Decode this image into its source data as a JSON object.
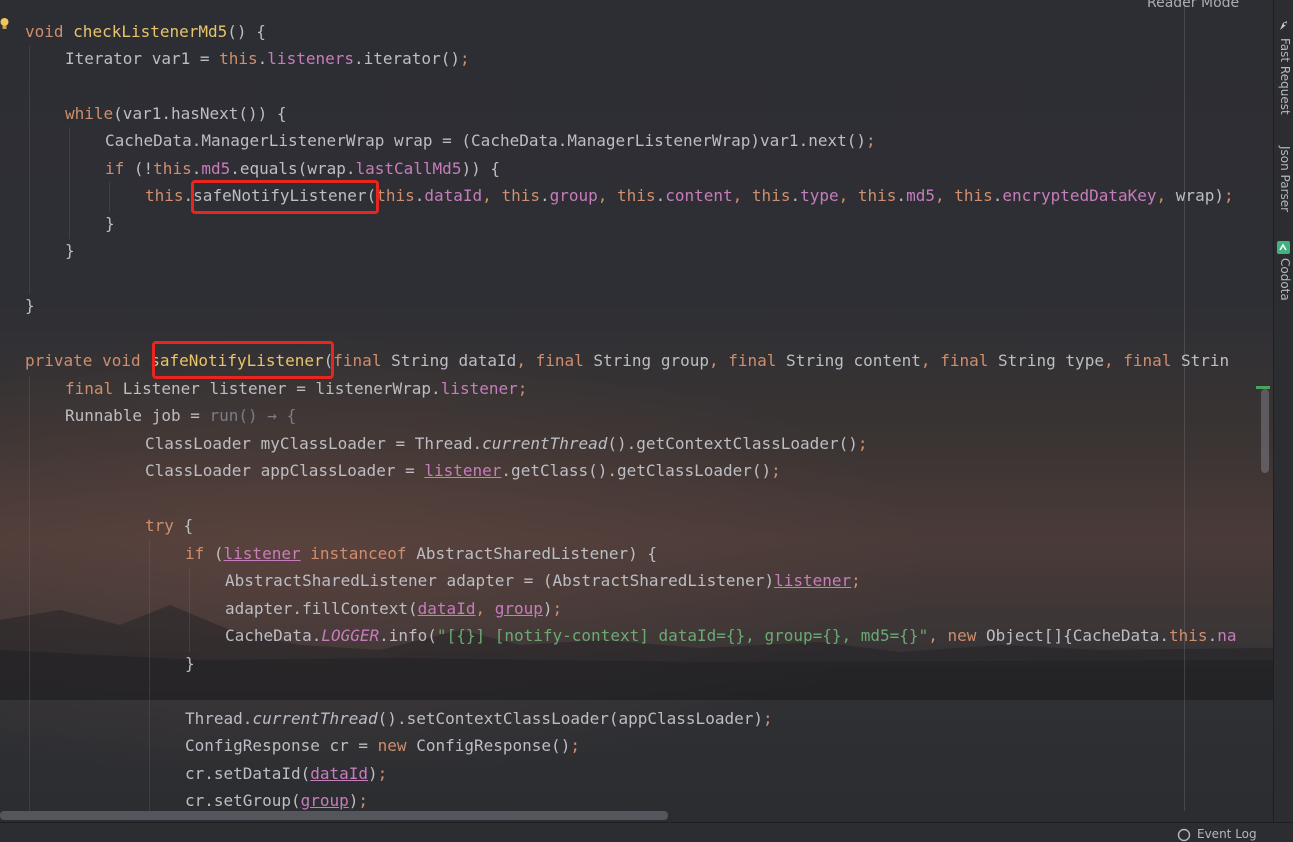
{
  "header": {
    "reader_mode": "Reader Mode"
  },
  "side_tools": [
    {
      "label": "Fast Request",
      "icon": "rocket-icon"
    },
    {
      "label": "Json Parser",
      "icon": "json-icon"
    },
    {
      "label": "Codota",
      "icon": "codota-icon"
    }
  ],
  "status_bar": {
    "event_log": "Event Log"
  },
  "colors": {
    "keyword": "#cf8e6d",
    "method_declaration": "#e8c46a",
    "field": "#c77dbb",
    "string": "#6aab73",
    "plain": "#bcbec4",
    "highlight_box": "#e8251f"
  },
  "code": {
    "l1_void": "void",
    "l1_name": "checkListenerMd5",
    "l1_rest": "() {",
    "l2_a": "Iterator var1 = ",
    "l2_this": "this",
    "l2_dot": ".",
    "l2_field": "listeners",
    "l2_b": ".iterator()",
    "l2_semi": ";",
    "l4_while": "while",
    "l4_rest": "(var1.hasNext()) {",
    "l5_a": "CacheData.ManagerListenerWrap wrap = (CacheData.ManagerListenerWrap)var1.next()",
    "l5_semi": ";",
    "l6_if": "if",
    "l6_a": " (!",
    "l6_this": "this",
    "l6_dot": ".",
    "l6_md5": "md5",
    "l6_b": ".equals(wrap.",
    "l6_last": "lastCallMd5",
    "l6_c": ")) {",
    "l7_this": "this",
    "l7_dot": ".",
    "l7_method": "safeNotifyListener",
    "l7_open": "(",
    "l7_args": [
      {
        "kw": "this",
        "field": "dataId",
        "sep": ", "
      },
      {
        "kw": "this",
        "field": "group",
        "sep": ", "
      },
      {
        "kw": "this",
        "field": "content",
        "sep": ", "
      },
      {
        "kw": "this",
        "field": "type",
        "sep": ", "
      },
      {
        "kw": "this",
        "field": "md5",
        "sep": ", "
      },
      {
        "kw": "this",
        "field": "encryptedDataKey",
        "sep": ", "
      }
    ],
    "l7_tail": "wrap)",
    "l7_semi": ";",
    "close_brace": "}",
    "l14_private": "private",
    "l14_void": "void",
    "l14_name": "safeNotifyListener",
    "l14_params": [
      {
        "kw": "final",
        "text": " String dataId",
        "sep": ", "
      },
      {
        "kw": "final",
        "text": " String group",
        "sep": ", "
      },
      {
        "kw": "final",
        "text": " String content",
        "sep": ", "
      },
      {
        "kw": "final",
        "text": " String type",
        "sep": ", "
      },
      {
        "kw": "final",
        "text": " Strin",
        "sep": ""
      }
    ],
    "l15_final": "final",
    "l15_a": " Listener listener = listenerWrap.",
    "l15_field": "listener",
    "l15_semi": ";",
    "l16_a": "Runnable job = ",
    "l16_lambda": "run() → {",
    "l17_a": "ClassLoader myClassLoader = Thread.",
    "l17_it": "currentThread",
    "l17_b": "().getContextClassLoader()",
    "l17_semi": ";",
    "l18_a": "ClassLoader appClassLoader = ",
    "l18_listener": "listener",
    "l18_b": ".getClass().getClassLoader()",
    "l18_semi": ";",
    "l20_try": "try",
    "l20_rest": " {",
    "l21_if": "if",
    "l21_a": " (",
    "l21_listener": "listener",
    "l21_instanceof": "instanceof",
    "l21_b": " AbstractSharedListener) {",
    "l22_a": "AbstractSharedListener adapter = (AbstractSharedListener)",
    "l22_listener": "listener",
    "l22_semi": ";",
    "l23_a": "adapter.fillContext(",
    "l23_p1": "dataId",
    "l23_sep": ", ",
    "l23_p2": "group",
    "l23_b": ")",
    "l23_semi": ";",
    "l24_a": "CacheData.",
    "l24_logger": "LOGGER",
    "l24_b": ".info(",
    "l24_str": "\"[{}] [notify-context] dataId={}, group={}, md5={}\"",
    "l24_c": ", ",
    "l24_new": "new",
    "l24_d": " Object[]{CacheData.",
    "l24_this": "this",
    "l24_e": ".",
    "l24_na": "na",
    "l27_a": "Thread.",
    "l27_it": "currentThread",
    "l27_b": "().setContextClassLoader(appClassLoader)",
    "l27_semi": ";",
    "l28_a": "ConfigResponse cr = ",
    "l28_new": "new",
    "l28_b": " ConfigResponse()",
    "l28_semi": ";",
    "l29_a": "cr.setDataId(",
    "l29_p": "dataId",
    "l29_b": ")",
    "l29_semi": ";",
    "l30_a": "cr.setGroup(",
    "l30_p": "group",
    "l30_b": ")",
    "l30_semi": ";"
  }
}
